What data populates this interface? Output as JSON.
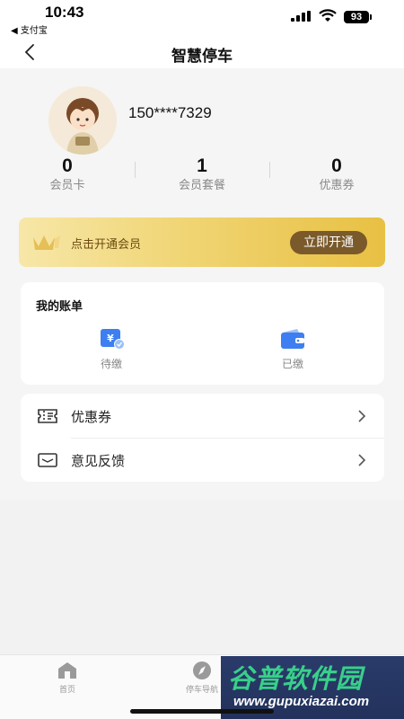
{
  "status_bar": {
    "time": "10:43",
    "back_app": "◀ 支付宝",
    "battery": "93"
  },
  "nav": {
    "title": "智慧停车",
    "back_icon": "chevron-left-icon"
  },
  "profile": {
    "phone": "150****7329",
    "avatar_icon": "cartoon-avatar"
  },
  "stats": [
    {
      "value": "0",
      "label": "会员卡"
    },
    {
      "value": "1",
      "label": "会员套餐"
    },
    {
      "value": "0",
      "label": "优惠券"
    }
  ],
  "vip": {
    "text": "点击开通会员",
    "button": "立即开通",
    "icon": "crown-icon"
  },
  "bills": {
    "title": "我的账单",
    "items": [
      {
        "label": "待缴",
        "icon": "yen-bill-icon"
      },
      {
        "label": "已缴",
        "icon": "wallet-icon"
      }
    ]
  },
  "menu": [
    {
      "label": "优惠券",
      "icon": "ticket-icon"
    },
    {
      "label": "意见反馈",
      "icon": "envelope-icon"
    }
  ],
  "tabs": [
    {
      "label": "首页",
      "icon": "home-icon"
    },
    {
      "label": "停车导航",
      "icon": "compass-icon"
    }
  ],
  "watermark": {
    "title": "谷普软件园",
    "url": "www.gupuxiazai.com"
  },
  "colors": {
    "accent_blue": "#3d7ff0",
    "vip_gold": "#e8c043",
    "vip_button": "#7a5a2a",
    "background": "#f2f2f2"
  }
}
